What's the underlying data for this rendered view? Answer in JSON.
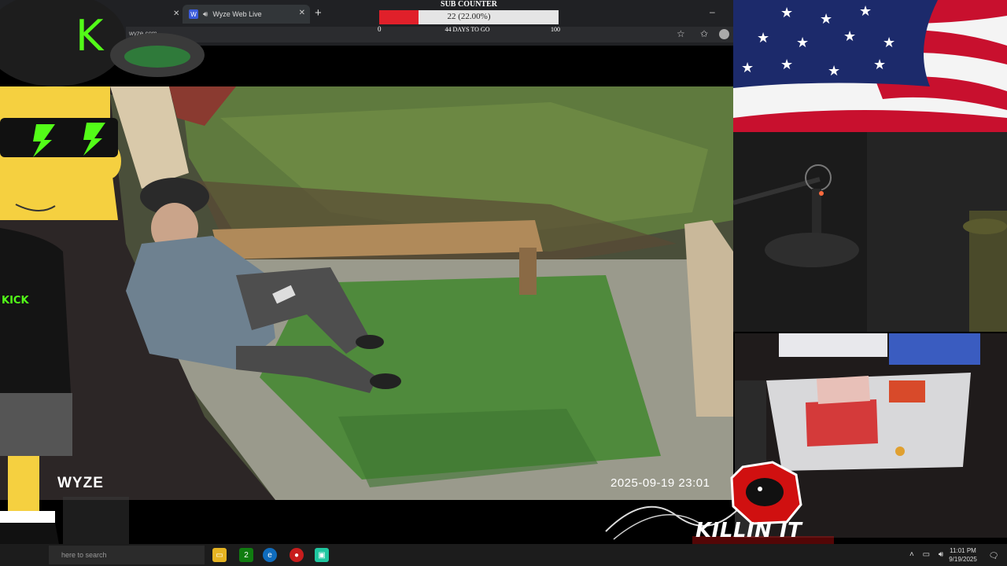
{
  "browser": {
    "tab_title": "Wyze Web Live",
    "tab_favicon": "W",
    "url": "wyze.com",
    "newtab_label": "+",
    "close_label": "✕",
    "minimize_label": "–"
  },
  "sub_counter": {
    "title": "SUB COUNTER",
    "value_text": "22 (22.00%)",
    "progress_fraction": 0.22,
    "min_label": "0",
    "days_label": "44 DAYS TO GO",
    "max_label": "100"
  },
  "camera": {
    "brand": "WYZE",
    "timestamp": "2025-09-19  23:01"
  },
  "overlay": {
    "hat_letter": "K",
    "shirt_text": "KICK",
    "logo_text": "KILLIN IT"
  },
  "taskbar": {
    "search_placeholder": "here to search",
    "time": "11:01 PM",
    "date": "9/19/2025",
    "xbox_badge": "2"
  },
  "colors": {
    "kick_green": "#53fc18",
    "counter_red": "#e0202a",
    "flag_red": "#c8102e",
    "flag_blue": "#1c2a6b"
  }
}
